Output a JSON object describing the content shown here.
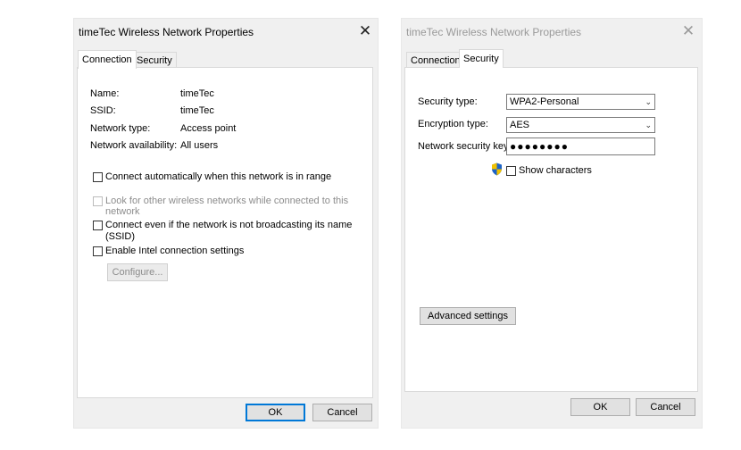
{
  "dialog_connection": {
    "title": "timeTec Wireless Network Properties",
    "close_glyph": "✕",
    "tabs": [
      "Connection",
      "Security"
    ],
    "info": [
      {
        "label": "Name:",
        "value": "timeTec"
      },
      {
        "label": "SSID:",
        "value": "timeTec"
      },
      {
        "label": "Network type:",
        "value": "Access point"
      },
      {
        "label": "Network availability:",
        "value": "All users"
      }
    ],
    "options": {
      "auto_connect": {
        "label": "Connect automatically when this network is in range",
        "checked": false,
        "enabled": true
      },
      "look_other": {
        "line1": "Look for other wireless networks while connected to this",
        "line2": "network",
        "checked": false,
        "enabled": false
      },
      "hidden_ssid": {
        "line1": "Connect even if the network is not broadcasting its name",
        "line2": "(SSID)",
        "checked": false,
        "enabled": true
      },
      "intel": {
        "label": "Enable Intel connection settings",
        "checked": false,
        "enabled": true
      }
    },
    "configure_label": "Configure...",
    "ok_label": "OK",
    "cancel_label": "Cancel"
  },
  "dialog_security": {
    "title": "timeTec Wireless Network Properties",
    "close_glyph": "✕",
    "tabs": [
      "Connection",
      "Security"
    ],
    "security_type_label": "Security type:",
    "security_type_value": "WPA2-Personal",
    "encryption_type_label": "Encryption type:",
    "encryption_type_value": "AES",
    "key_label": "Network security key",
    "key_value": "●●●●●●●●",
    "show_characters_label": "Show characters",
    "show_characters_checked": false,
    "advanced_label": "Advanced settings",
    "ok_label": "OK",
    "cancel_label": "Cancel",
    "shield_icon": "uac-shield-icon"
  },
  "colors": {
    "dialog_bg": "#f0f0f0",
    "panel_bg": "#ffffff",
    "default_button_border": "#0078d7",
    "disabled_text": "#8c8c8c"
  }
}
